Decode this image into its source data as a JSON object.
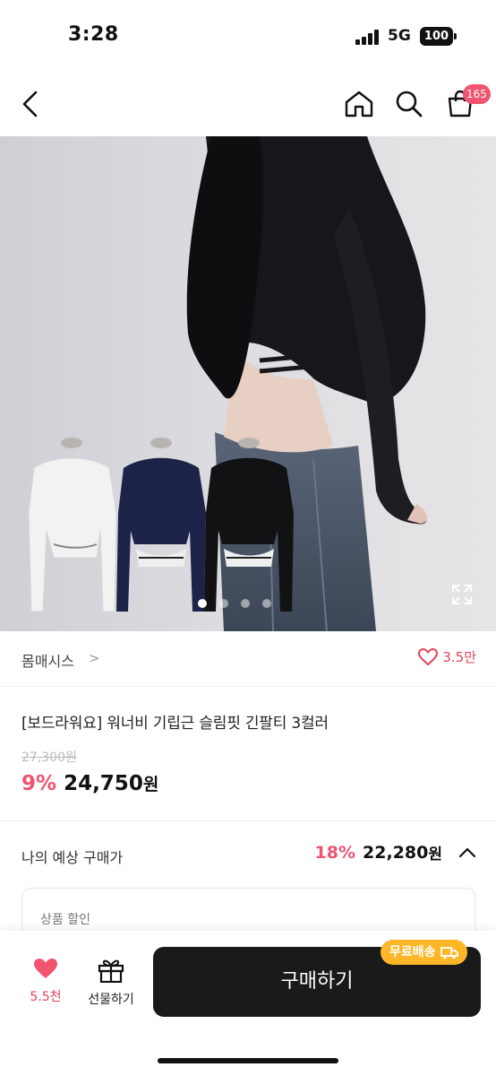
{
  "status_bar": {
    "time": "3:28",
    "network": "5G",
    "battery": "100"
  },
  "header": {
    "cart_count": "165"
  },
  "hero": {
    "slide_index": 1,
    "slide_count": 4
  },
  "brand": {
    "name": "몸매시스",
    "chevron": ">",
    "like_count": "3.5만"
  },
  "product": {
    "title": "[보드라워요] 워너비 기립근 슬림핏 긴팔티 3컬러",
    "original_price": "27,300원",
    "discount": "9%",
    "price": "24,750",
    "price_unit": "원"
  },
  "expected": {
    "label": "나의 예상 구매가",
    "discount": "18%",
    "price": "22,280",
    "unit": "원"
  },
  "discount_detail": {
    "label": "상품 할인"
  },
  "bottom_bar": {
    "wish_count": "5.5천",
    "gift_label": "선물하기",
    "buy_label": "구매하기",
    "free_shipping": "무료배송"
  },
  "colors": {
    "accent": "#f0546f",
    "buy_button": "#1a1a1a",
    "free_ship": "#ffb627"
  },
  "icons": [
    "back-icon",
    "home-icon",
    "search-icon",
    "cart-icon",
    "expand-icon",
    "heart-icon",
    "gift-icon",
    "truck-icon"
  ]
}
